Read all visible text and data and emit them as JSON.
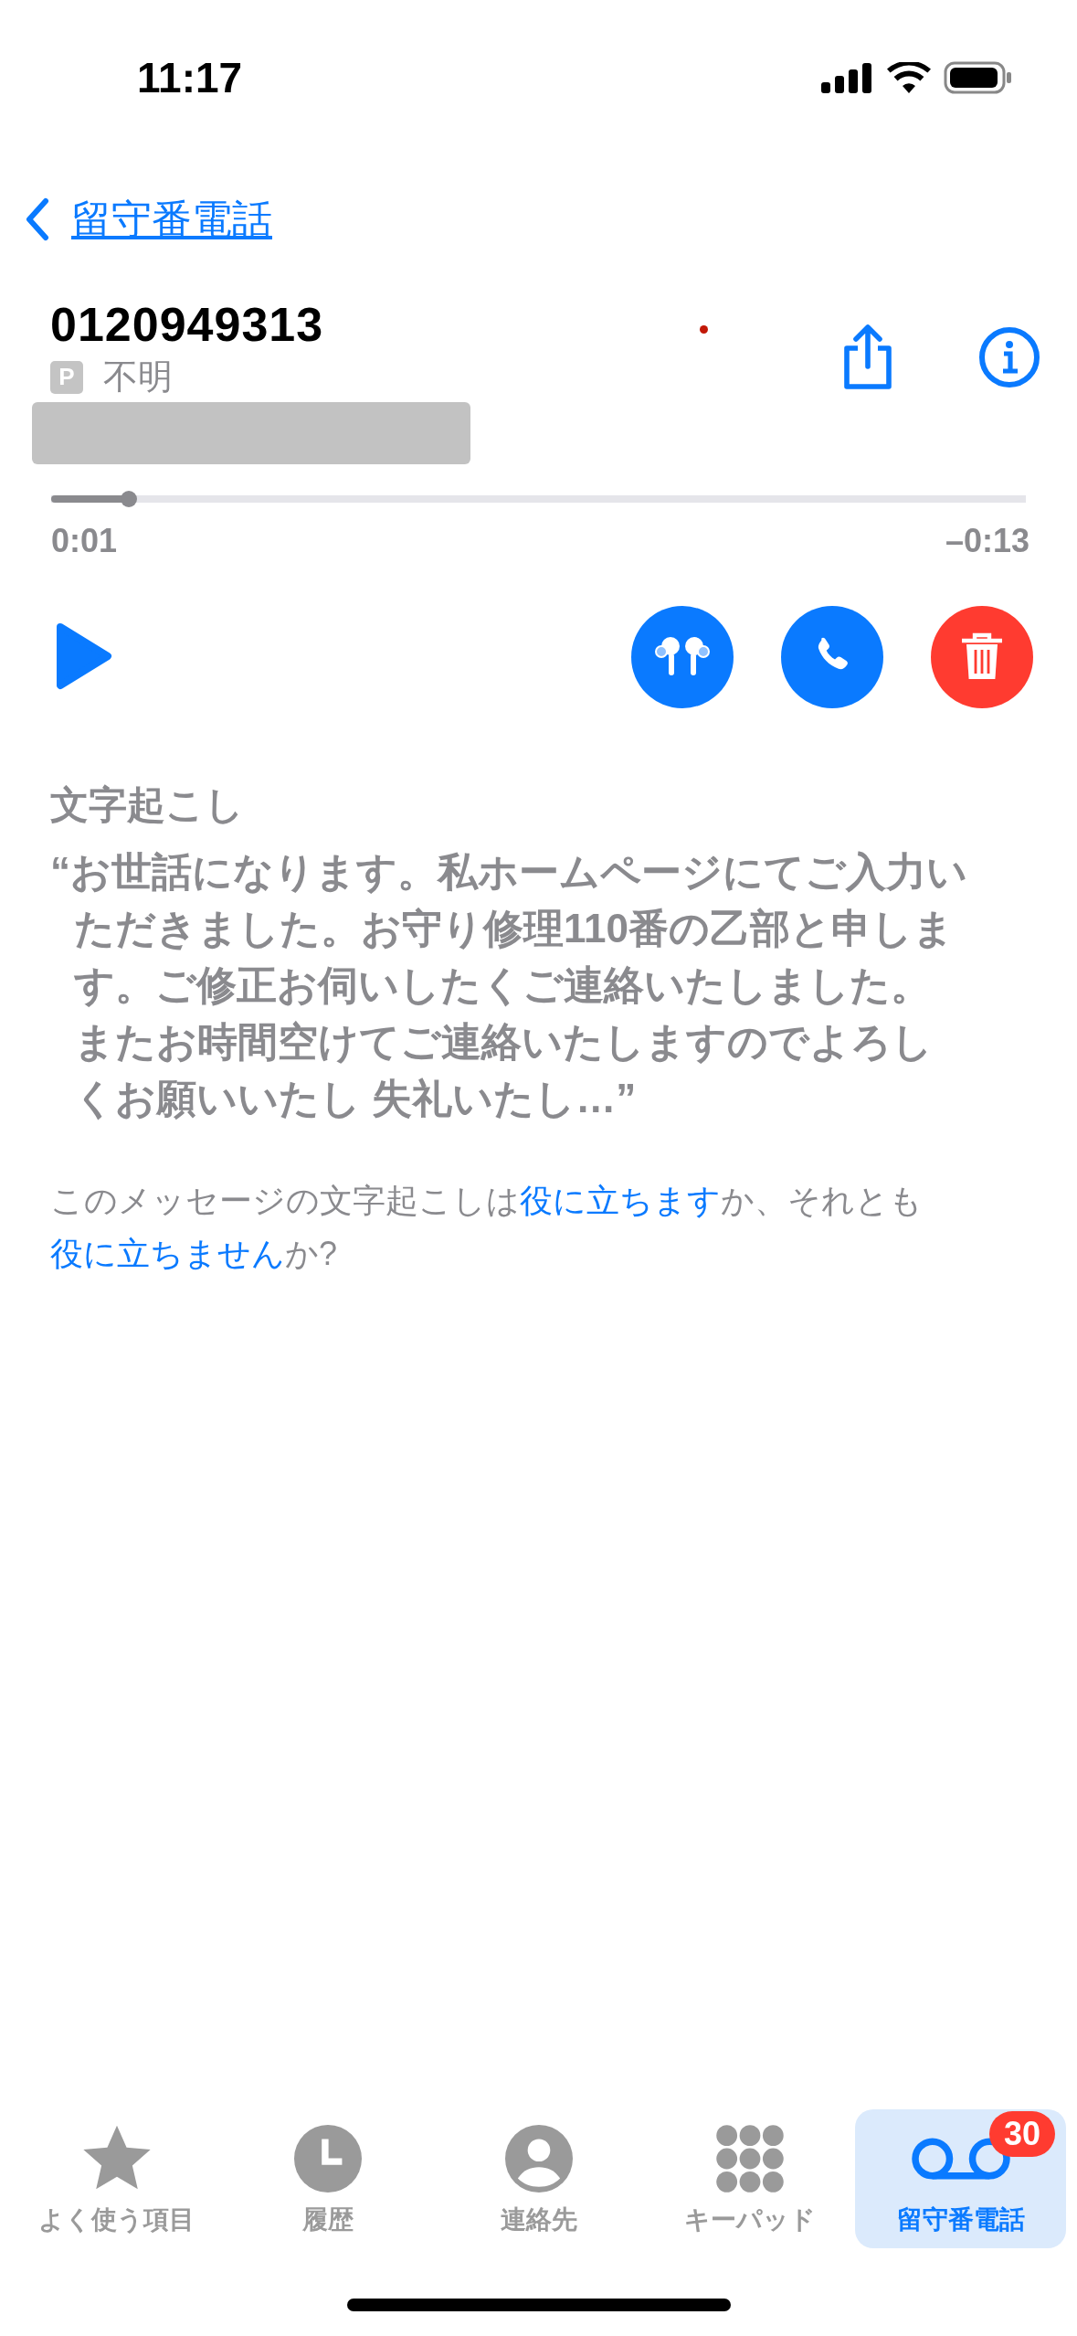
{
  "status_bar": {
    "time": "11:17"
  },
  "nav": {
    "back_label": "留守番電話"
  },
  "caller": {
    "number": "0120949313",
    "badge": "P",
    "label": "不明"
  },
  "playback": {
    "level": 0.08,
    "elapsed": "0:01",
    "remaining": "–0:13"
  },
  "transcription": {
    "heading": "文字起こし",
    "text": "“お世話になります。私ホームページにてご入力いただきました。お守り修理110番の乙部と申します。ご修正お伺いしたくご連絡いたしました。またお時間空けてご連絡いたしますのでよろしくお願いいたし 失礼いたし…”"
  },
  "feedback": [
    {
      "kind": "text",
      "text": "このメッセージの文字起こしは"
    },
    {
      "kind": "link",
      "text": "役に立ちます"
    },
    {
      "kind": "text",
      "text": "か、それとも"
    },
    {
      "kind": "link",
      "text": "役に立ちません"
    },
    {
      "kind": "text",
      "text": "か?"
    }
  ],
  "tabs": [
    {
      "kind": "favorites",
      "label": "よく使う項目",
      "selected": false
    },
    {
      "kind": "recents",
      "label": "履歴",
      "selected": false
    },
    {
      "kind": "contacts",
      "label": "連絡先",
      "selected": false
    },
    {
      "kind": "keypad",
      "label": "キーパッド",
      "selected": false
    },
    {
      "kind": "voicemail",
      "label": "留守番電話",
      "selected": true,
      "badge": "30"
    }
  ]
}
